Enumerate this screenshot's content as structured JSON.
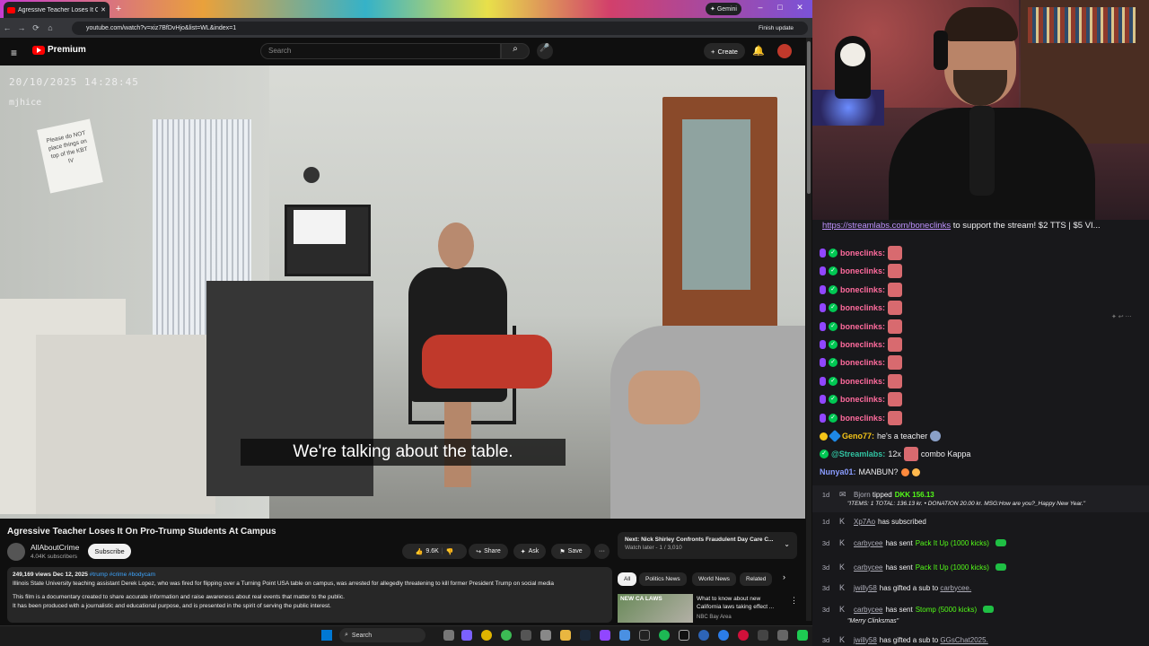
{
  "browser": {
    "tab_title": "Agressive Teacher Loses It O",
    "new_tab": "+",
    "gemini": "Gemini",
    "url": "youtube.com/watch?v=xiz7BfDvHjo&list=WL&index=1",
    "finish_update": "Finish update",
    "win_min": "–",
    "win_max": "□",
    "win_close": "✕"
  },
  "youtube": {
    "menu_icon": "≡",
    "logo_text": "Premium",
    "search_placeholder": "Search",
    "search_icon": "⌕",
    "mic_icon": "🎤",
    "create_label": "Create",
    "bell_icon": "🔔",
    "video": {
      "overlay_datetime": "20/10/2025 14:28:45",
      "overlay_id": "mjhice",
      "sign_text": "Please do NOT place things on top of the KBT IV",
      "caption": "We're talking about the table."
    },
    "title": "Agressive Teacher Loses It On Pro-Trump Students At Campus",
    "channel": {
      "name": "AllAboutCrime",
      "subs": "4.04K subscribers",
      "subscribe": "Subscribe"
    },
    "actions": {
      "likes": "9.6K",
      "share": "Share",
      "ask": "Ask",
      "save": "Save",
      "more": "···"
    },
    "description": {
      "meta": "249,169 views  Dec 12, 2025",
      "tags": "#trump #crime #bodycam",
      "line1": "Illinois State University teaching assistant Derek Lopez, who was fired for flipping over a Turning Point USA table on campus, was arrested for allegedly threatening to kill former President Trump on social media",
      "line2": "This film is a documentary created to share accurate information and raise awareness about real events that matter to the public.",
      "line3": "It has been produced with a journalistic and educational purpose, and is presented in the spirit of serving the public interest."
    },
    "next": {
      "label": "Next:",
      "title": "Nick Shirley Confronts Fraudulent Day Care C...",
      "sub": "Watch later - 1 / 3,010"
    },
    "chips": [
      "All",
      "Politics News",
      "World News",
      "Related"
    ],
    "related": {
      "thumb_text": "NEW CA LAWS",
      "title": "What to know about new California laws taking effect ...",
      "channel": "NBC Bay Area"
    }
  },
  "taskbar": {
    "search": "Search"
  },
  "chat": {
    "promo_link": "https://streamlabs.com/boneclinks",
    "promo_text": " to support the stream! $2 TTS | $5 VI...",
    "bone_rows": [
      {
        "user": "boneclinks:"
      },
      {
        "user": "boneclinks:"
      },
      {
        "user": "boneclinks:"
      },
      {
        "user": "boneclinks:"
      },
      {
        "user": "boneclinks:"
      },
      {
        "user": "boneclinks:"
      },
      {
        "user": "boneclinks:"
      },
      {
        "user": "boneclinks:"
      },
      {
        "user": "boneclinks:"
      },
      {
        "user": "boneclinks:"
      }
    ],
    "geno": {
      "user": "Geno77:",
      "msg": "he's a teacher"
    },
    "streamlabs": {
      "user": "@Streamlabs:",
      "msg1": "12x",
      "msg2": "combo Kappa"
    },
    "nunya": {
      "user": "Nunya01:",
      "msg": "MANBUN?"
    },
    "events": [
      {
        "age": "1d",
        "who": "Bjorn",
        "action": "tipped",
        "amount": "DKK 156.13",
        "detail": "\"ITEMS: 1 TOTAL: 136.13 kr. • DONATION 20.00 kr. MSG:How are you?_Happy New Year.\""
      },
      {
        "age": "1d",
        "who": "Xp7Ao",
        "action": "has subscribed"
      },
      {
        "age": "3d",
        "who": "carbycee",
        "action": "has sent",
        "item": "Pack It Up (1000 kicks)"
      },
      {
        "age": "3d",
        "who": "carbycee",
        "action": "has sent",
        "item": "Pack It Up (1000 kicks)"
      },
      {
        "age": "3d",
        "who": "jwilly58",
        "action": "has gifted a sub to",
        "target": "carbycee."
      },
      {
        "age": "3d",
        "who": "carbycee",
        "action": "has sent",
        "item": "Stomp (5000 kicks)",
        "detail": "\"Merry Clinksmas\""
      },
      {
        "age": "3d",
        "who": "jwilly58",
        "action": "has gifted a sub to",
        "target": "GGsChat2025."
      }
    ]
  },
  "colors": {
    "yt_red": "#ff0000",
    "chat_bg": "#18181b",
    "bone_name": "#ff6b9d",
    "geno_name": "#f5c518",
    "streamlabs_name": "#31c3a2",
    "nunya_name": "#8a9cff",
    "kick_green": "#53fc18"
  }
}
